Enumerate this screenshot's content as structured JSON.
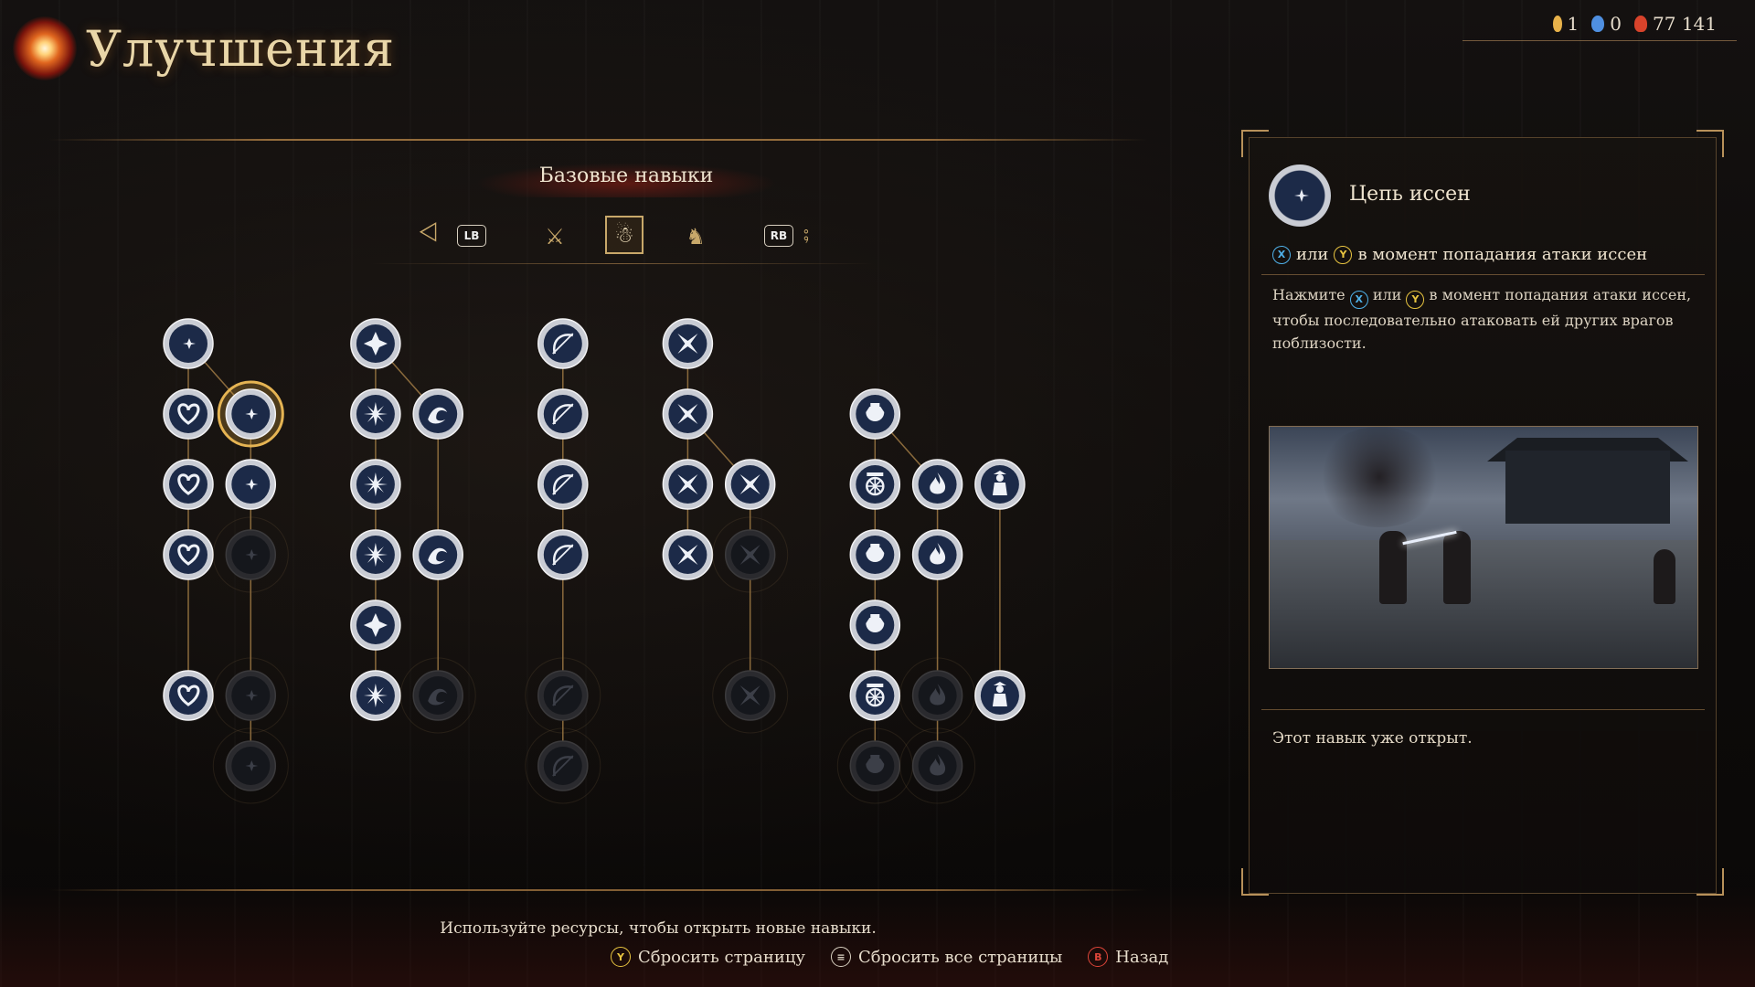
{
  "header": {
    "title": "Улучшения"
  },
  "currency": [
    {
      "icon": "key-icon",
      "value": "1",
      "color": "#e8b24a"
    },
    {
      "icon": "water-drop-icon",
      "value": "0",
      "color": "#4f8fe0"
    },
    {
      "icon": "flame-icon",
      "value": "77 141",
      "color": "#d8432b"
    }
  ],
  "tree_section": {
    "title": "Базовые навыки",
    "tabs": [
      {
        "icon": "katana-icon"
      },
      {
        "icon": "meditating-figure-icon",
        "active": true
      },
      {
        "icon": "samurai-helmet-icon"
      }
    ],
    "lb_label": "LB",
    "rb_label": "RB"
  },
  "skill_tree": {
    "nodes": [
      {
        "col": 0,
        "row": 0,
        "glyph": "moon-star",
        "unlocked": true
      },
      {
        "col": 0,
        "row": 1,
        "glyph": "heart-wave",
        "unlocked": true
      },
      {
        "col": 1,
        "row": 1,
        "glyph": "moon-star",
        "unlocked": true,
        "selected": true
      },
      {
        "col": 0,
        "row": 2,
        "glyph": "heart-wave",
        "unlocked": true
      },
      {
        "col": 1,
        "row": 2,
        "glyph": "moon-star",
        "unlocked": true
      },
      {
        "col": 0,
        "row": 3,
        "glyph": "heart-wave",
        "unlocked": true
      },
      {
        "col": 1,
        "row": 3,
        "glyph": "moon-star",
        "unlocked": false
      },
      {
        "col": 0,
        "row": 5,
        "glyph": "heart-wave",
        "unlocked": true
      },
      {
        "col": 1,
        "row": 5,
        "glyph": "moon-star",
        "unlocked": false
      },
      {
        "col": 1,
        "row": 6,
        "glyph": "moon-star",
        "unlocked": false
      },
      {
        "col": 3,
        "row": 0,
        "glyph": "diamond-star",
        "unlocked": true
      },
      {
        "col": 3,
        "row": 1,
        "glyph": "burst",
        "unlocked": true
      },
      {
        "col": 4,
        "row": 1,
        "glyph": "wave",
        "unlocked": true
      },
      {
        "col": 3,
        "row": 2,
        "glyph": "burst",
        "unlocked": true
      },
      {
        "col": 3,
        "row": 3,
        "glyph": "burst",
        "unlocked": true
      },
      {
        "col": 4,
        "row": 3,
        "glyph": "wave",
        "unlocked": true
      },
      {
        "col": 3,
        "row": 4,
        "glyph": "diamond-star",
        "unlocked": true
      },
      {
        "col": 3,
        "row": 5,
        "glyph": "burst",
        "unlocked": true
      },
      {
        "col": 4,
        "row": 5,
        "glyph": "wave",
        "unlocked": false
      },
      {
        "col": 6,
        "row": 0,
        "glyph": "bow",
        "unlocked": true
      },
      {
        "col": 6,
        "row": 1,
        "glyph": "bow",
        "unlocked": true
      },
      {
        "col": 6,
        "row": 2,
        "glyph": "bow",
        "unlocked": true
      },
      {
        "col": 6,
        "row": 3,
        "glyph": "bow",
        "unlocked": true
      },
      {
        "col": 6,
        "row": 5,
        "glyph": "bow",
        "unlocked": false
      },
      {
        "col": 6,
        "row": 6,
        "glyph": "bow",
        "unlocked": false
      },
      {
        "col": 8,
        "row": 0,
        "glyph": "shuriken",
        "unlocked": true
      },
      {
        "col": 8,
        "row": 1,
        "glyph": "shuriken",
        "unlocked": true
      },
      {
        "col": 8,
        "row": 2,
        "glyph": "shuriken",
        "unlocked": true
      },
      {
        "col": 9,
        "row": 2,
        "glyph": "shuriken",
        "unlocked": true
      },
      {
        "col": 8,
        "row": 3,
        "glyph": "shuriken",
        "unlocked": true
      },
      {
        "col": 9,
        "row": 3,
        "glyph": "shuriken",
        "unlocked": false
      },
      {
        "col": 9,
        "row": 5,
        "glyph": "shuriken",
        "unlocked": false
      },
      {
        "col": 11,
        "row": 1,
        "glyph": "pot",
        "unlocked": true
      },
      {
        "col": 11,
        "row": 2,
        "glyph": "wheel",
        "unlocked": true
      },
      {
        "col": 12,
        "row": 2,
        "glyph": "flame",
        "unlocked": true
      },
      {
        "col": 13,
        "row": 2,
        "glyph": "figure",
        "unlocked": true
      },
      {
        "col": 11,
        "row": 3,
        "glyph": "pot",
        "unlocked": true
      },
      {
        "col": 12,
        "row": 3,
        "glyph": "flame",
        "unlocked": true
      },
      {
        "col": 11,
        "row": 4,
        "glyph": "pot",
        "unlocked": true
      },
      {
        "col": 11,
        "row": 5,
        "glyph": "wheel",
        "unlocked": true
      },
      {
        "col": 12,
        "row": 5,
        "glyph": "flame",
        "unlocked": false
      },
      {
        "col": 13,
        "row": 5,
        "glyph": "figure",
        "unlocked": true
      },
      {
        "col": 11,
        "row": 6,
        "glyph": "pot",
        "unlocked": false
      },
      {
        "col": 12,
        "row": 6,
        "glyph": "flame",
        "unlocked": false
      }
    ]
  },
  "detail": {
    "name": "Цепь иссен",
    "condition_or": "или",
    "condition_text": "в момент попадания атаки иссен",
    "desc_1": "Нажмите",
    "desc_or": "или",
    "desc_2": "в момент попадания атаки иссен, чтобы последовательно атаковать ей других врагов поблизости.",
    "status": "Этот навык уже открыт."
  },
  "footer": {
    "hint": "Используйте ресурсы, чтобы открыть новые навыки.",
    "reset_page": "Сбросить страницу",
    "reset_all": "Сбросить все страницы",
    "back": "Назад"
  },
  "colors": {
    "accent_gold": "#c8a86a",
    "node_fill": "#1c2a48",
    "button_x": "#4fb0e8",
    "button_y": "#e8c440",
    "button_b": "#e0463a"
  }
}
